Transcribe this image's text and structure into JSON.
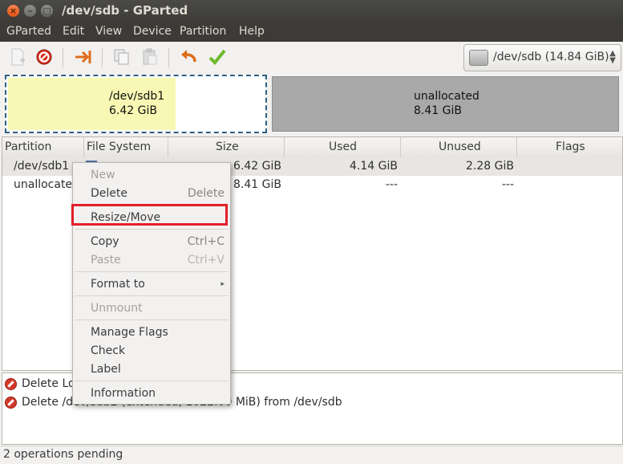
{
  "window": {
    "title": "/dev/sdb - GParted"
  },
  "menubar": [
    "GParted",
    "Edit",
    "View",
    "Device",
    "Partition",
    "Help"
  ],
  "toolbar": {
    "icons": [
      "new-icon",
      "delete-icon",
      "resize-move-icon",
      "copy-icon",
      "paste-icon",
      "undo-icon",
      "apply-icon"
    ]
  },
  "device_select": {
    "value": "/dev/sdb   (14.84 GiB)"
  },
  "partition_map": {
    "sdb1": {
      "name": "/dev/sdb1",
      "size": "6.42 GiB",
      "used_fraction": 0.65
    },
    "unallocated": {
      "name": "unallocated",
      "size": "8.41 GiB"
    }
  },
  "table": {
    "columns": [
      "Partition",
      "File System",
      "Size",
      "Used",
      "Unused",
      "Flags"
    ],
    "rows": [
      {
        "partition": "/dev/sdb1",
        "filesystem": "",
        "size": "6.42 GiB",
        "used": "4.14 GiB",
        "unused": "2.28 GiB",
        "flags": ""
      },
      {
        "partition": "unallocated",
        "filesystem": "",
        "size": "8.41 GiB",
        "used": "---",
        "unused": "---",
        "flags": ""
      }
    ]
  },
  "context_menu": {
    "new": {
      "label": "New",
      "accel": ""
    },
    "delete": {
      "label": "Delete",
      "accel": "Delete"
    },
    "resize": {
      "label": "Resize/Move",
      "accel": ""
    },
    "copy": {
      "label": "Copy",
      "accel": "Ctrl+C"
    },
    "paste": {
      "label": "Paste",
      "accel": "Ctrl+V"
    },
    "format": {
      "label": "Format to",
      "accel": ""
    },
    "unmount": {
      "label": "Unmount",
      "accel": ""
    },
    "flags": {
      "label": "Manage Flags",
      "accel": ""
    },
    "check": {
      "label": "Check",
      "accel": ""
    },
    "label": {
      "label": "Label",
      "accel": ""
    },
    "info": {
      "label": "Information",
      "accel": ""
    }
  },
  "log": [
    "Delete Lo                                 21.00 MiB) from /dev/sdb",
    "Delete /dev/sdb2 (extended, 1022.00 MiB) from /dev/sdb"
  ],
  "status": "2 operations pending"
}
